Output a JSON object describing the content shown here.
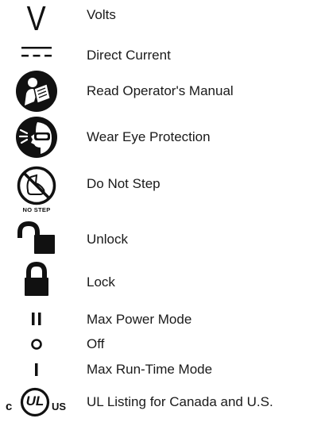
{
  "symbols": [
    {
      "icon": "volts-icon",
      "label": "Volts",
      "glyph": "V"
    },
    {
      "icon": "direct-current-icon",
      "label": "Direct Current"
    },
    {
      "icon": "read-manual-icon",
      "label": "Read Operator's Manual"
    },
    {
      "icon": "eye-protection-icon",
      "label": "Wear Eye Protection"
    },
    {
      "icon": "no-step-icon",
      "label": "Do Not Step",
      "icon_text": "NO STEP"
    },
    {
      "icon": "unlock-icon",
      "label": "Unlock"
    },
    {
      "icon": "lock-icon",
      "label": "Lock"
    },
    {
      "icon": "max-power-mode-icon",
      "label": "Max Power Mode"
    },
    {
      "icon": "off-icon",
      "label": "Off"
    },
    {
      "icon": "max-run-time-mode-icon",
      "label": "Max Run-Time Mode"
    },
    {
      "icon": "ul-listing-icon",
      "label": "UL Listing for Canada and U.S.",
      "icon_text": {
        "left": "c",
        "center": "UL",
        "right": "US"
      }
    }
  ]
}
